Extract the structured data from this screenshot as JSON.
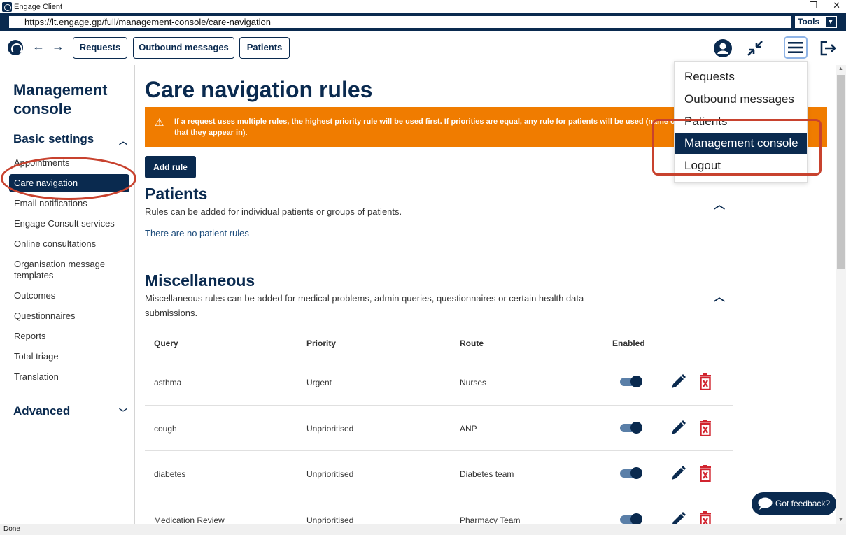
{
  "window": {
    "title": "Engage Client",
    "controls": [
      "–",
      "❐",
      "✕"
    ]
  },
  "address": {
    "url": "https://lt.engage.gp/full/management-console/care-navigation",
    "tools_label": "Tools"
  },
  "toolbar": {
    "requests": "Requests",
    "outbound": "Outbound messages",
    "patients": "Patients"
  },
  "sidebar": {
    "title": "Management console",
    "basic_settings": "Basic settings",
    "items": [
      "Appointments",
      "Care navigation",
      "Email notifications",
      "Engage Consult services",
      "Online consultations",
      "Organisation message templates",
      "Outcomes",
      "Questionnaires",
      "Reports",
      "Total triage",
      "Translation"
    ],
    "advanced": "Advanced"
  },
  "main": {
    "title": "Care navigation rules",
    "banner": "If a request uses multiple rules, the highest priority rule will be used first. If priorities are equal, any rule for patients will be used (name of patient group that they appear in).",
    "add_rule": "Add rule",
    "patients": {
      "heading": "Patients",
      "description": "Rules can be added for individual patients or groups of patients.",
      "empty": "There are no patient rules"
    },
    "misc": {
      "heading": "Miscellaneous",
      "description": "Miscellaneous rules can be added for medical problems, admin queries, questionnaires or certain health data submissions."
    },
    "table": {
      "headers": [
        "Query",
        "Priority",
        "Route",
        "Enabled"
      ],
      "rows": [
        {
          "query": "asthma",
          "priority": "Urgent",
          "route": "Nurses"
        },
        {
          "query": "cough",
          "priority": "Unprioritised",
          "route": "ANP"
        },
        {
          "query": "diabetes",
          "priority": "Unprioritised",
          "route": "Diabetes team"
        },
        {
          "query": "Medication Review",
          "priority": "Unprioritised",
          "route": "Pharmacy Team"
        }
      ]
    }
  },
  "dropdown": {
    "items": [
      "Requests",
      "Outbound messages",
      "Patients",
      "Management console",
      "Logout"
    ],
    "active_index": 3
  },
  "feedback": "Got feedback?",
  "status": "Done",
  "colors": {
    "brand": "#0a2a4f",
    "warning": "#f07c00",
    "delete": "#d1242f",
    "annotation": "#c8422e"
  }
}
